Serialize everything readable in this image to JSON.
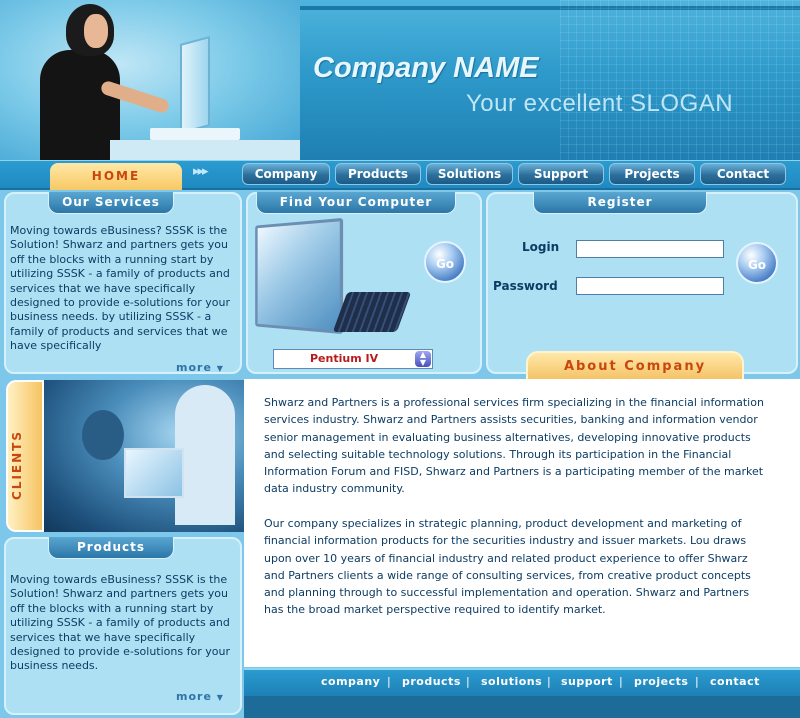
{
  "header": {
    "company_name": "Company NAME",
    "slogan": "Your excellent SLOGAN"
  },
  "nav": {
    "home": "HOME",
    "items": [
      "Company",
      "Products",
      "Solutions",
      "Support",
      "Projects",
      "Contact"
    ]
  },
  "services": {
    "title": "Our Services",
    "text": "Moving towards eBusiness? SSSK is the Solution!  Shwarz and partners gets you off the blocks with a running start by utilizing SSSK - a family of products and services that we have specifically designed to provide e-solutions for your business needs. by utilizing SSSK - a family of products and services that we have specifically",
    "more": "more"
  },
  "find_computer": {
    "title": "Find Your Computer",
    "go": "Go",
    "selected": "Pentium IV"
  },
  "register": {
    "title": "Register",
    "login_label": "Login",
    "password_label": "Password",
    "login_value": "",
    "password_value": "",
    "go": "Go"
  },
  "about": {
    "tab": "About Company",
    "paragraph1": "Shwarz and Partners is a professional services firm specializing in the financial information services industry. Shwarz and Partners assists securities, banking and information vendor senior management in evaluating business alternatives, developing innovative products and selecting suitable technology solutions. Through its participation in the Financial Information Forum and FISD, Shwarz and Partners is a participating member of the market data industry community.",
    "paragraph2": "Our company specializes in strategic planning, product development and marketing of financial information products for the securities industry and issuer markets. Lou draws upon over 10 years of financial industry and related product experience to offer Shwarz and Partners clients a wide range of consulting services, from creative product concepts and planning through to successful implementation and operation. Shwarz and Partners has the broad market perspective required to identify market."
  },
  "clients": {
    "label": "CLIENTS"
  },
  "products": {
    "title": "Products",
    "text": "Moving towards eBusiness? SSSK is the Solution!  Shwarz and partners gets you off the blocks with a running start by utilizing SSSK - a family of products and services that we have specifically designed to provide e-solutions for your business needs.",
    "more": "more"
  },
  "footer": {
    "links": [
      "company",
      "products",
      "solutions",
      "support",
      "projects",
      "contact"
    ],
    "separator": "|"
  },
  "colors": {
    "accent": "#c8470e",
    "panel": "#aee0f4",
    "header": "#2e9acb"
  }
}
